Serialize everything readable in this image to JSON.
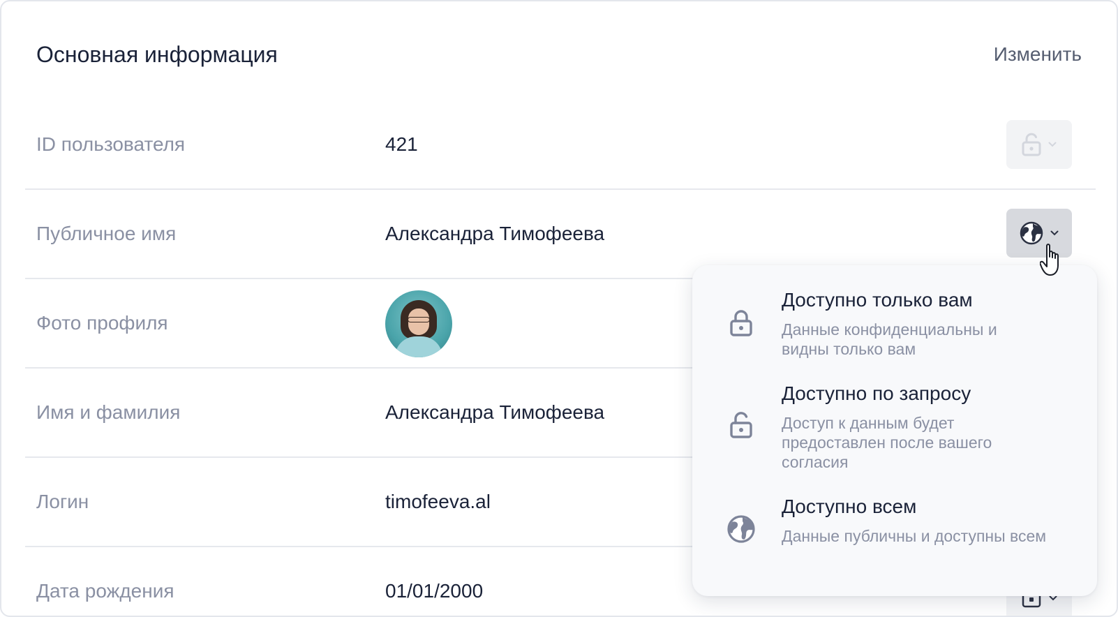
{
  "header": {
    "title": "Основная информация",
    "edit_label": "Изменить"
  },
  "rows": [
    {
      "label": "ID пользователя",
      "value": "421",
      "privacy_icon": "lock-open-icon",
      "privacy_state": "disabled"
    },
    {
      "label": "Публичное имя",
      "value": "Александра Тимофеева",
      "privacy_icon": "globe-icon",
      "privacy_state": "active"
    },
    {
      "label": "Фото профиля",
      "value": "",
      "avatar": "profile-photo"
    },
    {
      "label": "Имя и фамилия",
      "value": "Александра Тимофеева"
    },
    {
      "label": "Логин",
      "value": "timofeeva.al"
    },
    {
      "label": "Дата рождения",
      "value": "01/01/2000",
      "privacy_icon": "calendar-icon"
    }
  ],
  "dropdown": {
    "options": [
      {
        "title": "Доступно только вам",
        "description": "Данные конфиденциальны и видны только вам",
        "icon": "lock-closed-icon"
      },
      {
        "title": "Доступно по запросу",
        "description": "Доступ к данным будет предоставлен после вашего согласия",
        "icon": "lock-open-icon"
      },
      {
        "title": "Доступно всем",
        "description": "Данные публичны и доступны всем",
        "icon": "globe-icon"
      }
    ]
  },
  "colors": {
    "text_primary": "#1a2238",
    "text_secondary": "#8a90a3",
    "icon": "#7d8499",
    "divider": "#e6e8ed"
  }
}
